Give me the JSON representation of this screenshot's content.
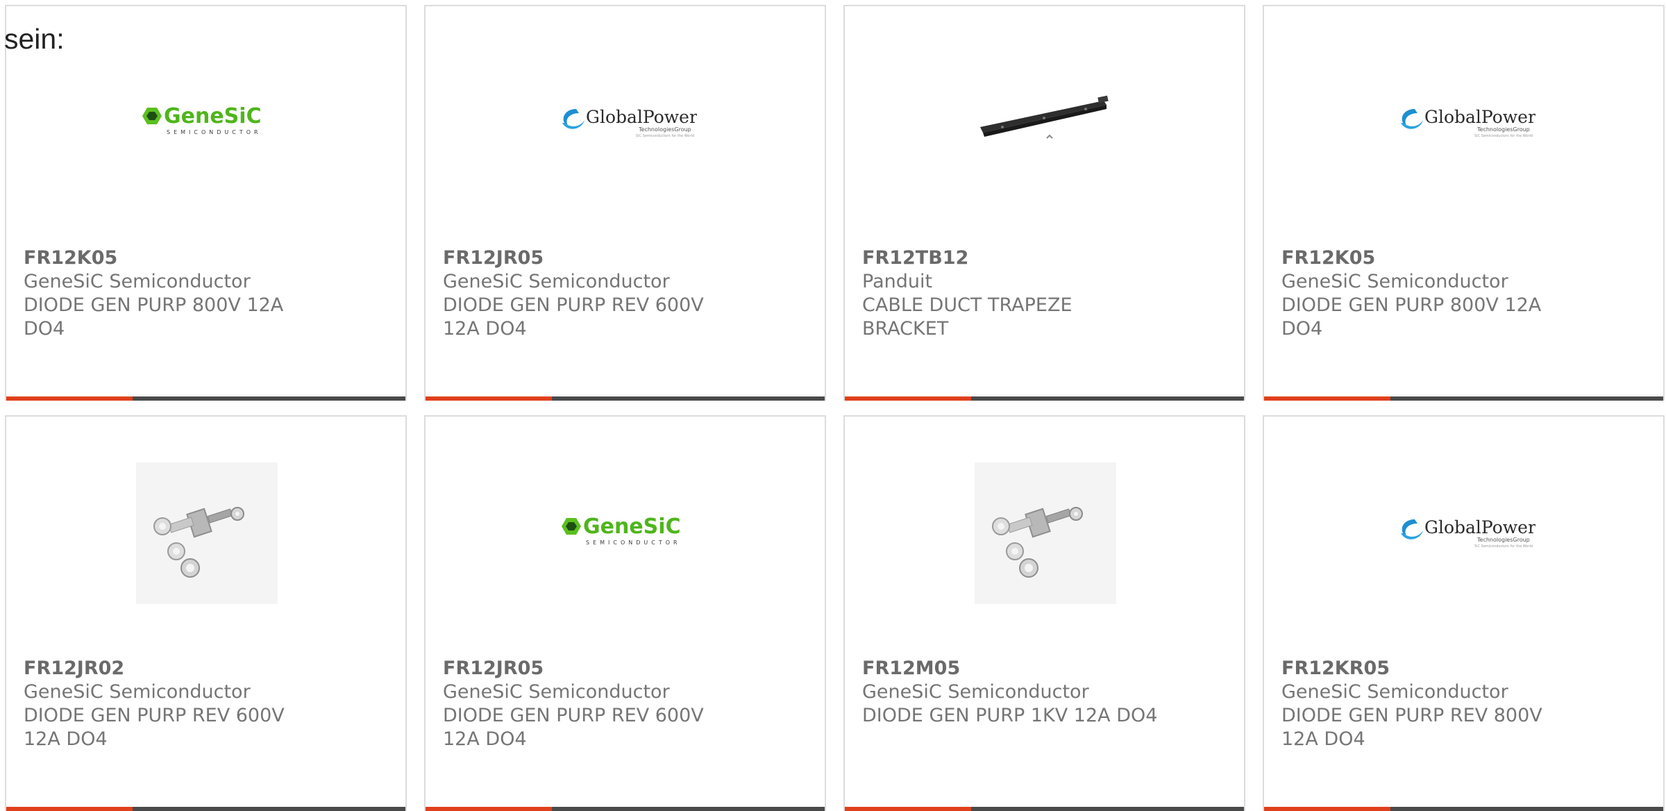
{
  "intro_text": "sein:",
  "colors": {
    "accent": "#e0401c",
    "bar": "#4a4a4a",
    "text": "#757575",
    "border": "#dcdcdc"
  },
  "products": [
    {
      "part": "FR12K05",
      "manufacturer": "GeneSiC Semiconductor",
      "description": "DIODE GEN PURP 800V 12A DO4",
      "image": "genesic-logo"
    },
    {
      "part": "FR12JR05",
      "manufacturer": "GeneSiC Semiconductor",
      "description": "DIODE GEN PURP REV 600V 12A DO4",
      "image": "globalpower-logo"
    },
    {
      "part": "FR12TB12",
      "manufacturer": "Panduit",
      "description": "CABLE DUCT TRAPEZE BRACKET",
      "image": "bracket-photo"
    },
    {
      "part": "FR12K05",
      "manufacturer": "GeneSiC Semiconductor",
      "description": "DIODE GEN PURP 800V 12A DO4",
      "image": "globalpower-logo"
    },
    {
      "part": "FR12JR02",
      "manufacturer": "GeneSiC Semiconductor",
      "description": "DIODE GEN PURP REV 600V 12A DO4",
      "image": "stud-diode-photo"
    },
    {
      "part": "FR12JR05",
      "manufacturer": "GeneSiC Semiconductor",
      "description": "DIODE GEN PURP REV 600V 12A DO4",
      "image": "genesic-logo"
    },
    {
      "part": "FR12M05",
      "manufacturer": "GeneSiC Semiconductor",
      "description": "DIODE GEN PURP 1KV 12A DO4",
      "image": "stud-diode-photo"
    },
    {
      "part": "FR12KR05",
      "manufacturer": "GeneSiC Semiconductor",
      "description": "DIODE GEN PURP REV 800V 12A DO4",
      "image": "globalpower-logo"
    }
  ]
}
